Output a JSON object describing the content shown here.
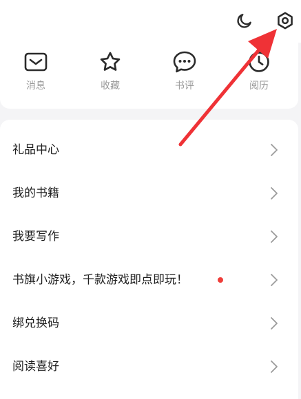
{
  "colors": {
    "icon": "#2b2b2b",
    "muted": "#9a9a9a",
    "chevron": "#9b9b9b",
    "red_dot": "#ef3e3a",
    "annotation_red": "#ef3236"
  },
  "header": {
    "night_mode_icon": "moon-icon",
    "settings_icon": "gear-icon"
  },
  "quick_actions": [
    {
      "label": "消息",
      "icon": "envelope-icon"
    },
    {
      "label": "收藏",
      "icon": "star-icon"
    },
    {
      "label": "书评",
      "icon": "chat-bubble-icon"
    },
    {
      "label": "阅历",
      "icon": "clock-icon"
    }
  ],
  "menu": {
    "items": [
      {
        "label": "礼品中心",
        "badge": false
      },
      {
        "label": "我的书籍",
        "badge": false
      },
      {
        "label": "我要写作",
        "badge": false
      },
      {
        "label": "书旗小游戏，千款游戏即点即玩！",
        "badge": true
      },
      {
        "label": "绑兑换码",
        "badge": false
      },
      {
        "label": "阅读喜好",
        "badge": false
      }
    ]
  }
}
